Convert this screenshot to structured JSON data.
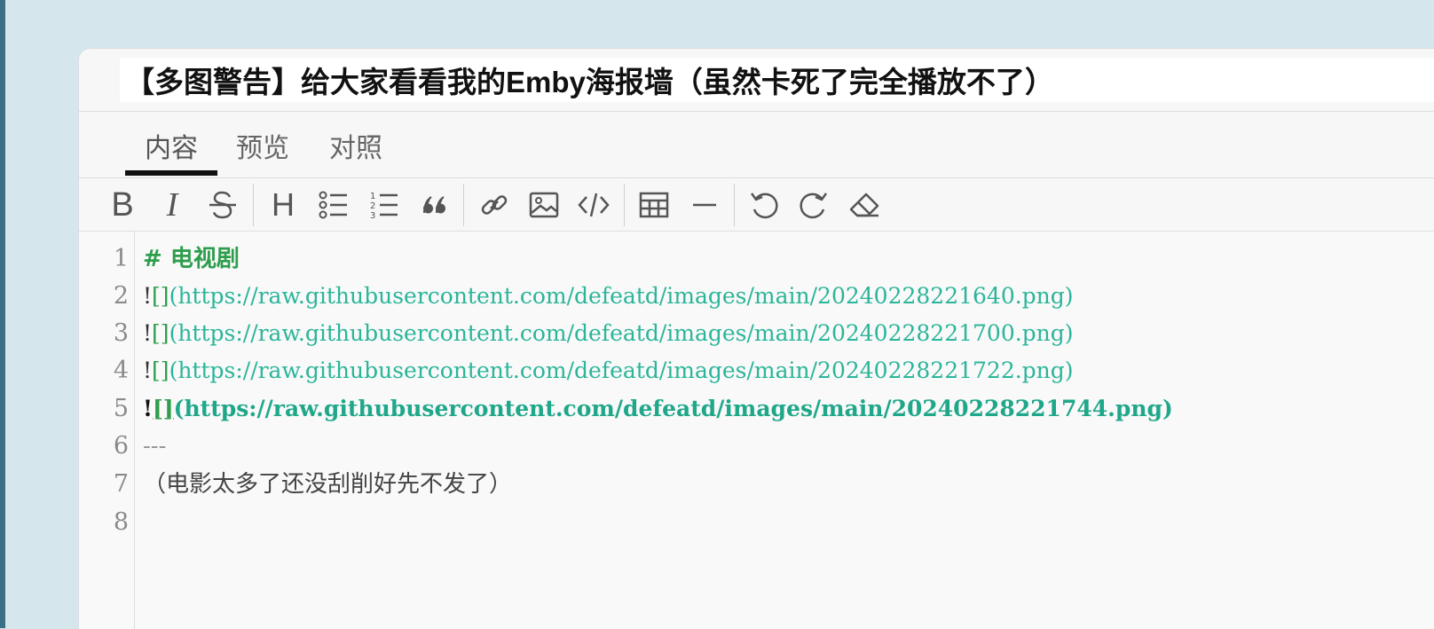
{
  "title": "【多图警告】给大家看看我的Emby海报墙（虽然卡死了完全播放不了）",
  "tabs": [
    {
      "label": "内容",
      "active": true
    },
    {
      "label": "预览",
      "active": false
    },
    {
      "label": "对照",
      "active": false
    }
  ],
  "toolbar": {
    "bold": "B",
    "italic": "I",
    "heading": "H"
  },
  "editor": {
    "line_numbers": [
      "1",
      "2",
      "3",
      "4",
      "5",
      "6",
      "7",
      "8"
    ],
    "line1_text": "# 电视剧",
    "bang": "!",
    "brackets": "[]",
    "line2_url": "(https://raw.githubusercontent.com/defeatd/images/main/20240228221640.png)",
    "line3_url": "(https://raw.githubusercontent.com/defeatd/images/main/20240228221700.png)",
    "line4_url": "(https://raw.githubusercontent.com/defeatd/images/main/20240228221722.png)",
    "line5_url": "(https://raw.githubusercontent.com/defeatd/images/main/20240228221744.png)",
    "line6_text": "---",
    "line7_text": "（电影太多了还没刮削好先不发了）"
  },
  "colors": {
    "heading_green": "#2e9e4d",
    "url_teal": "#2bb59a",
    "background": "#d5e6ec"
  }
}
